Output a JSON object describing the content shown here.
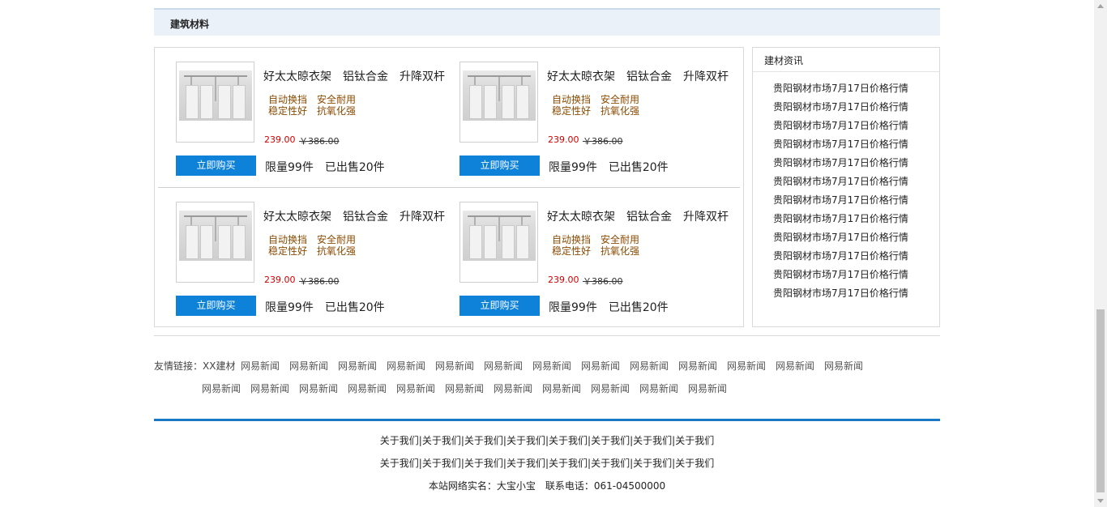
{
  "section": {
    "title": "建筑材料"
  },
  "products": [
    {
      "name": "好太太晾衣架　铝钛合金　升降双杆",
      "features": [
        "自动换挡　安全耐用",
        "稳定性好　抗氧化强"
      ],
      "price": "239.00",
      "old_price": "￥386.00",
      "buy_label": "立即购买",
      "stock": "限量99件　已出售20件"
    },
    {
      "name": "好太太晾衣架　铝钛合金　升降双杆",
      "features": [
        "自动换挡　安全耐用",
        "稳定性好　抗氧化强"
      ],
      "price": "239.00",
      "old_price": "￥386.00",
      "buy_label": "立即购买",
      "stock": "限量99件　已出售20件"
    },
    {
      "name": "好太太晾衣架　铝钛合金　升降双杆",
      "features": [
        "自动换挡　安全耐用",
        "稳定性好　抗氧化强"
      ],
      "price": "239.00",
      "old_price": "￥386.00",
      "buy_label": "立即购买",
      "stock": "限量99件　已出售20件"
    },
    {
      "name": "好太太晾衣架　铝钛合金　升降双杆",
      "features": [
        "自动换挡　安全耐用",
        "稳定性好　抗氧化强"
      ],
      "price": "239.00",
      "old_price": "￥386.00",
      "buy_label": "立即购买",
      "stock": "限量99件　已出售20件"
    }
  ],
  "news": {
    "title": "建材资讯",
    "items": [
      "贵阳钢材市场7月17日价格行情",
      "贵阳钢材市场7月17日价格行情",
      "贵阳钢材市场7月17日价格行情",
      "贵阳钢材市场7月17日价格行情",
      "贵阳钢材市场7月17日价格行情",
      "贵阳钢材市场7月17日价格行情",
      "贵阳钢材市场7月17日价格行情",
      "贵阳钢材市场7月17日价格行情",
      "贵阳钢材市场7月17日价格行情",
      "贵阳钢材市场7月17日价格行情",
      "贵阳钢材市场7月17日价格行情",
      "贵阳钢材市场7月17日价格行情"
    ]
  },
  "friend_links": {
    "label": "友情链接：XX建材",
    "items": [
      "网易新闻",
      "网易新闻",
      "网易新闻",
      "网易新闻",
      "网易新闻",
      "网易新闻",
      "网易新闻",
      "网易新闻",
      "网易新闻",
      "网易新闻",
      "网易新闻",
      "网易新闻",
      "网易新闻",
      "网易新闻",
      "网易新闻",
      "网易新闻",
      "网易新闻",
      "网易新闻",
      "网易新闻",
      "网易新闻",
      "网易新闻",
      "网易新闻",
      "网易新闻",
      "网易新闻"
    ]
  },
  "footer": {
    "row1": [
      "关于我们",
      "关于我们",
      "关于我们",
      "关于我们",
      "关于我们",
      "关于我们",
      "关于我们",
      "关于我们"
    ],
    "row2": [
      "关于我们",
      "关于我们",
      "关于我们",
      "关于我们",
      "关于我们",
      "关于我们",
      "关于我们",
      "关于我们"
    ],
    "record": "本站网络实名：大宝小宝　联系电话：061-04500000"
  },
  "colors": {
    "accent": "#0d82d8",
    "price": "#d40000",
    "feature": "#8a4a00",
    "footer_rule": "#1b78c4"
  }
}
